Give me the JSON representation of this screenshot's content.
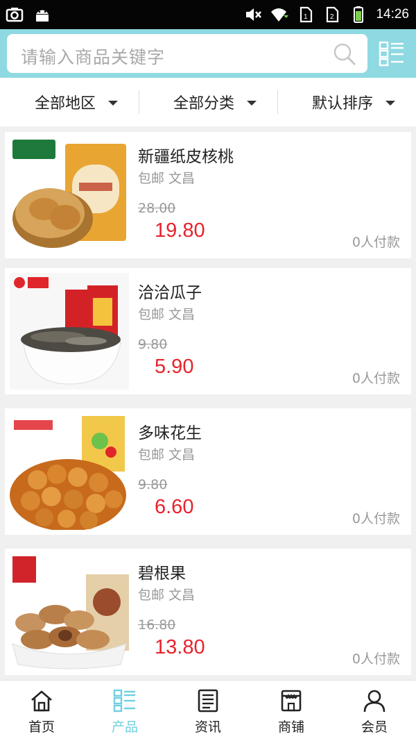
{
  "status_bar": {
    "time": "14:26",
    "left_icons": [
      "camera-icon",
      "android-icon"
    ],
    "right_icons": [
      "mute-icon",
      "wifi-icon",
      "sim-1-icon",
      "sim-2-icon",
      "battery-icon"
    ]
  },
  "search": {
    "placeholder": "请输入商品关键字",
    "search_icon": "search-icon",
    "menu_icon": "category-grid-icon"
  },
  "filters": [
    {
      "label": "全部地区"
    },
    {
      "label": "全部分类"
    },
    {
      "label": "默认排序"
    }
  ],
  "products": [
    {
      "name": "新疆纸皮核桃",
      "tags": "包邮 文昌",
      "old_price": "28.00",
      "price": "19.80",
      "sold": "0人付款",
      "image": "walnut-product-image"
    },
    {
      "name": "洽洽瓜子",
      "tags": "包邮 文昌",
      "old_price": "9.80",
      "price": "5.90",
      "sold": "0人付款",
      "image": "sunflower-seeds-product-image"
    },
    {
      "name": "多味花生",
      "tags": "包邮 文昌",
      "old_price": "9.80",
      "price": "6.60",
      "sold": "0人付款",
      "image": "peanut-product-image"
    },
    {
      "name": "碧根果",
      "tags": "包邮 文昌",
      "old_price": "16.80",
      "price": "13.80",
      "sold": "0人付款",
      "image": "pecan-product-image"
    }
  ],
  "tabs": [
    {
      "label": "首页",
      "icon": "home-icon"
    },
    {
      "label": "产品",
      "icon": "product-grid-icon",
      "active": true
    },
    {
      "label": "资讯",
      "icon": "news-icon"
    },
    {
      "label": "商铺",
      "icon": "store-icon"
    },
    {
      "label": "会员",
      "icon": "user-icon"
    }
  ],
  "colors": {
    "header_bg": "#8ed9e2",
    "price_red": "#e8222b",
    "tab_active": "#6fcfe0"
  }
}
